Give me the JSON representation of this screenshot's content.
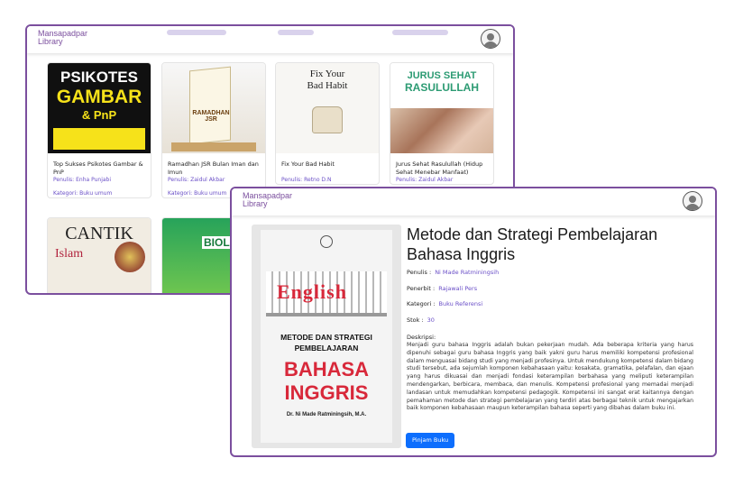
{
  "brand": {
    "line1": "Mansapadpar",
    "line2": "Library"
  },
  "colors": {
    "accent": "#7b4f9e",
    "link": "#6a4fc7",
    "button": "#0d6efd"
  },
  "icons": {
    "profile": "user-circle-icon"
  },
  "catalog": {
    "books": [
      {
        "title": "Top Sukses Psikotes Gambar & PnP",
        "author_label": "Penulis:",
        "author": "Enha Punjabi",
        "category_label": "Kategori:",
        "category": "Buku umum",
        "cover": {
          "top": "PSIKOTES",
          "mid": "GAMBAR",
          "bottom": "& PnP"
        }
      },
      {
        "title": "Ramadhan JSR Bulan Iman dan Imun",
        "author_label": "Penulis:",
        "author": "Zaidul Akbar",
        "category_label": "Kategori:",
        "category": "Buku umum",
        "cover": {
          "text": "RAMADHAN JSR"
        }
      },
      {
        "title": "Fix Your Bad Habit",
        "author_label": "Penulis:",
        "author": "Retno D.N",
        "cover": {
          "text": "Fix Your Bad Habit"
        }
      },
      {
        "title": "Jurus Sehat Rasulullah (Hidup Sehat Menebar Manfaat)",
        "author_label": "Penulis:",
        "author": "Zaidul Akbar",
        "cover": {
          "top": "JURUS SEHAT",
          "mid": "RASULULLAH"
        }
      },
      {
        "cover": {
          "top": "CANTIK",
          "mid": "Islam"
        }
      },
      {
        "cover": {
          "text": "BIOLO"
        }
      }
    ]
  },
  "detail": {
    "title": "Metode dan Strategi Pembelajaran Bahasa Inggris",
    "author_label": "Penulis :",
    "author": "Ni Made Ratminingsih",
    "publisher_label": "Penerbit :",
    "publisher": "Rajawali Pers",
    "category_label": "Kategori :",
    "category": "Buku Referensi",
    "stock_label": "Stok :",
    "stock": "30",
    "description_label": "Deskripsi:",
    "description": "Menjadi guru bahasa Inggris adalah bukan pekerjaan mudah. Ada beberapa kriteria yang harus dipenuhi sebagai guru bahasa Inggris yang baik yakni guru harus memiliki kompetensi profesional dalam menguasai bidang studi yang menjadi profesinya. Untuk mendukung kompetensi dalam bidang studi tersebut, ada sejumlah komponen kebahasaan yaitu: kosakata, gramatika, pelafalan, dan ejaan yang harus dikuasai dan menjadi fondasi keterampilan berbahasa yang meliputi keterampilan mendengarkan, berbicara, membaca, dan menulis. Kompetensi profesional yang memadai menjadi landasan untuk memudahkan kompetensi pedagogik. Kompetensi ini sangat erat kaitannya dengan pemahaman metode dan strategi pembelajaran yang terdiri atas berbagai teknik untuk mengajarkan baik komponen kebahasaan maupun keterampilan bahasa seperti yang dibahas dalam buku ini.",
    "borrow_button": "Pinjam Buku",
    "cover": {
      "word": "English",
      "line1": "METODE DAN STRATEGI",
      "line2": "PEMBELAJARAN",
      "line3": "BAHASA",
      "line4": "INGGRIS",
      "author": "Dr. Ni Made Ratminingsih, M.A."
    }
  }
}
